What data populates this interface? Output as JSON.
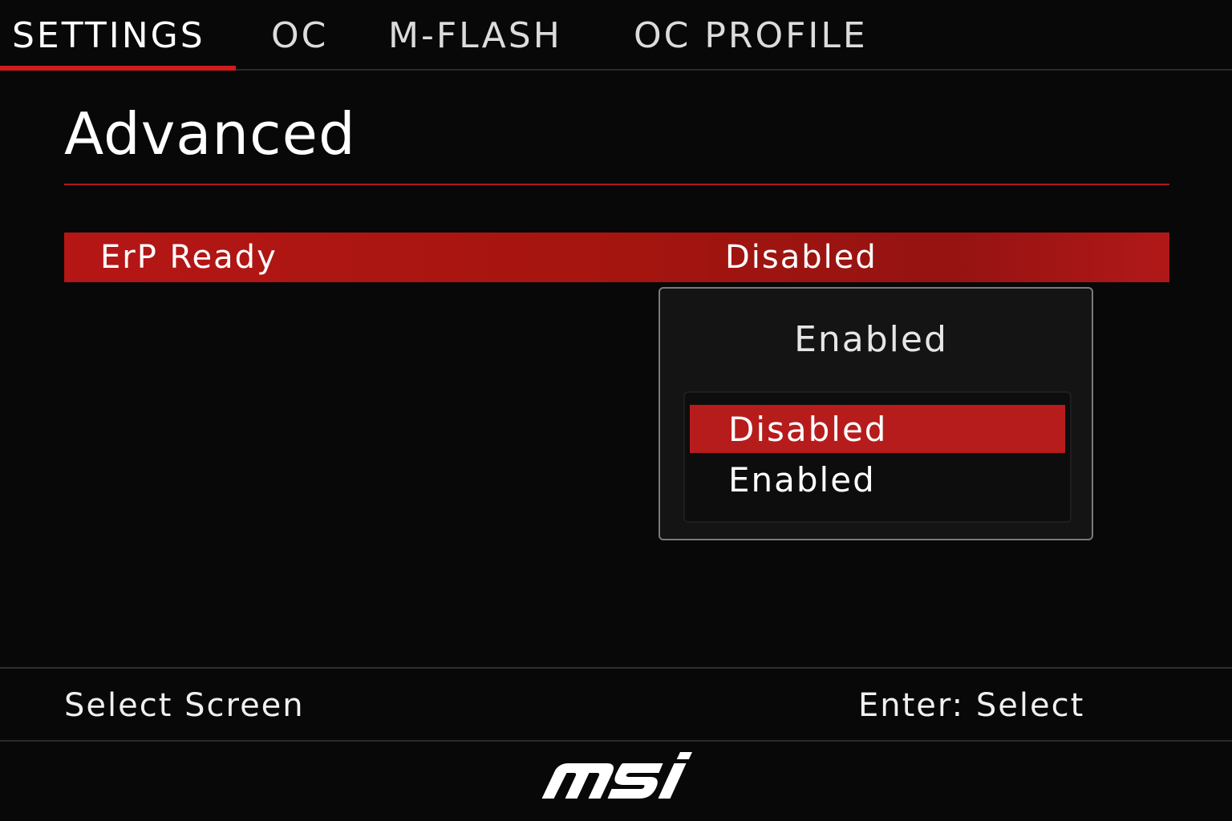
{
  "tabs": [
    {
      "label": "SETTINGS",
      "active": true
    },
    {
      "label": "OC",
      "active": false
    },
    {
      "label": "M-FLASH",
      "active": false
    },
    {
      "label": "OC PROFILE",
      "active": false
    }
  ],
  "page": {
    "title": "Advanced"
  },
  "setting": {
    "label": "ErP Ready",
    "value": "Disabled"
  },
  "popup": {
    "title": "Enabled",
    "options": [
      "Disabled",
      "Enabled"
    ],
    "selected_index": 0
  },
  "help": {
    "left": "Select Screen",
    "right": "Enter: Select"
  },
  "logo": {
    "text": "msi"
  },
  "colors": {
    "accent": "#d01c1c",
    "highlight": "#b71c1c",
    "background": "#080808"
  }
}
